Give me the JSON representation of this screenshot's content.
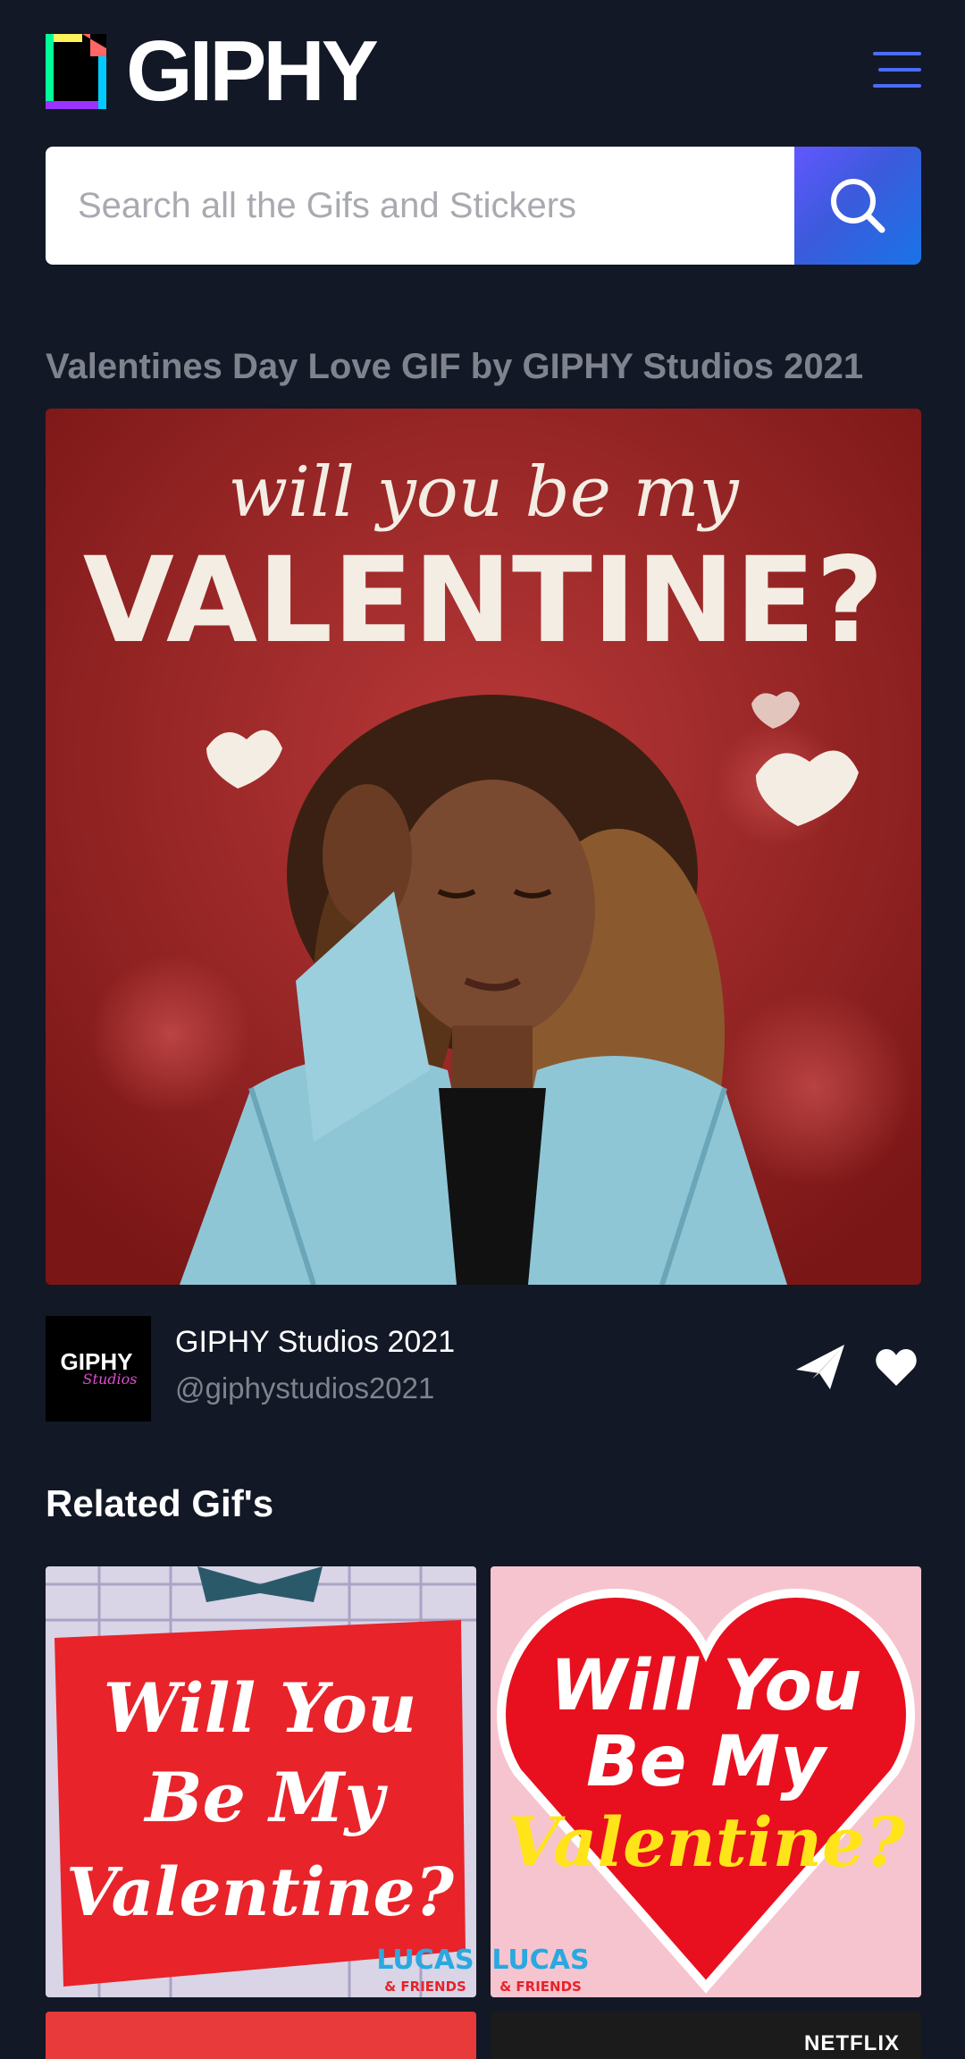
{
  "header": {
    "logo_text": "GIPHY",
    "menu_icon": "hamburger-menu-icon"
  },
  "search": {
    "placeholder": "Search all the Gifs and Stickers",
    "icon": "search-icon"
  },
  "gif": {
    "title": "Valentines Day Love GIF by GIPHY Studios 2021",
    "image_text_line1": "will you be my",
    "image_text_line2": "VALENTINE?"
  },
  "creator": {
    "name": "GIPHY Studios 2021",
    "handle": "@giphystudios2021",
    "avatar_text": "GIPHY",
    "avatar_subtext": "Studios",
    "share_icon": "paper-plane-icon",
    "like_icon": "heart-icon"
  },
  "related": {
    "heading": "Related Gif's",
    "tiles": [
      {
        "line1": "Will You",
        "line2": "Be My",
        "line3": "Valentine?",
        "badge1": "LUCAS",
        "badge2": "& FRIENDS"
      },
      {
        "line1": "Will You",
        "line2": "Be My",
        "line3": "Valentine?",
        "badge1": "LUCAS",
        "badge2": "& FRIENDS"
      },
      {
        "label": ""
      },
      {
        "label": "NETFLIX"
      }
    ]
  },
  "colors": {
    "background": "#121826",
    "title_gray": "#7f838d",
    "search_gradient_start": "#6157ff",
    "search_gradient_end": "#1a73e8"
  }
}
